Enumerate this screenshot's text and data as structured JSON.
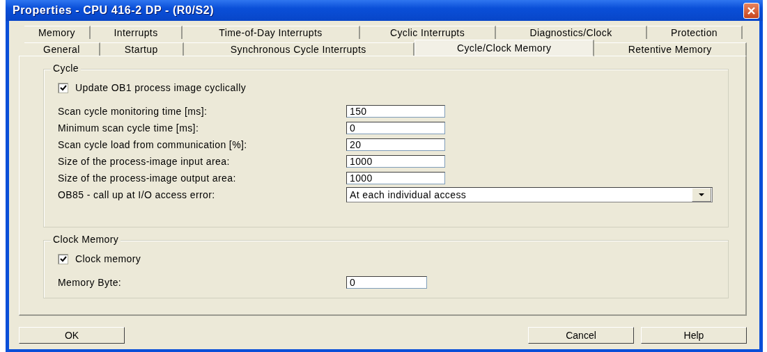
{
  "window": {
    "title": "Properties - CPU 416-2 DP - (R0/S2)"
  },
  "tab_rows": [
    {
      "tabs": [
        {
          "label": "Memory",
          "selected": false
        },
        {
          "label": "Interrupts",
          "selected": false
        },
        {
          "label": "Time-of-Day Interrupts",
          "selected": false
        },
        {
          "label": "Cyclic Interrupts",
          "selected": false
        },
        {
          "label": "Diagnostics/Clock",
          "selected": false
        },
        {
          "label": "Protection",
          "selected": false
        }
      ]
    },
    {
      "tabs": [
        {
          "label": "General",
          "selected": false
        },
        {
          "label": "Startup",
          "selected": false
        },
        {
          "label": "Synchronous Cycle Interrupts",
          "selected": false
        },
        {
          "label": "Cycle/Clock Memory",
          "selected": true
        },
        {
          "label": "Retentive Memory",
          "selected": false
        }
      ]
    }
  ],
  "groups": [
    {
      "title": "Cycle",
      "checkbox": {
        "label": "Update OB1 process image cyclically",
        "checked": true
      },
      "fields": [
        {
          "kind": "text",
          "label": "Scan cycle monitoring time [ms]:",
          "value": "150"
        },
        {
          "kind": "text",
          "label": "Minimum scan cycle time [ms]:",
          "value": "0"
        },
        {
          "kind": "text",
          "label": "Scan cycle load from communication [%]:",
          "value": "20"
        },
        {
          "kind": "text",
          "label": "Size of the process-image input area:",
          "value": "1000"
        },
        {
          "kind": "text",
          "label": "Size of the process-image output area:",
          "value": "1000"
        },
        {
          "kind": "dropdown",
          "label": "OB85 - call up at I/O access error:",
          "value": "At each individual access"
        }
      ]
    },
    {
      "title": "Clock Memory",
      "checkbox": {
        "label": "Clock memory",
        "checked": true
      },
      "fields": [
        {
          "kind": "short",
          "label": "Memory Byte:",
          "value": "0"
        }
      ]
    }
  ],
  "buttons": [
    "OK",
    "Cancel",
    "Help"
  ]
}
